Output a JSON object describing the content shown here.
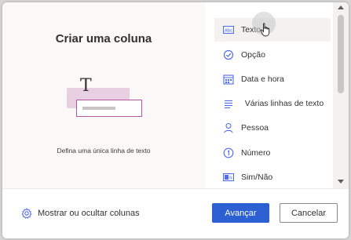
{
  "dialog": {
    "title": "Criar uma coluna",
    "description": "Defina uma única linha de texto",
    "illustration_letter": "T"
  },
  "column_types": [
    {
      "label": "Texto",
      "icon": "text-field-icon",
      "selected": true
    },
    {
      "label": "Opção",
      "icon": "check-circle-icon",
      "selected": false
    },
    {
      "label": "Data e hora",
      "icon": "calendar-icon",
      "selected": false
    },
    {
      "label": "Várias linhas de texto",
      "icon": "multiline-text-icon",
      "selected": false
    },
    {
      "label": "Pessoa",
      "icon": "person-icon",
      "selected": false
    },
    {
      "label": "Número",
      "icon": "number-icon",
      "selected": false
    },
    {
      "label": "Sim/Não",
      "icon": "toggle-icon",
      "selected": false
    }
  ],
  "footer": {
    "show_hide_label": "Mostrar ou ocultar colunas",
    "next_label": "Avançar",
    "cancel_label": "Cancelar"
  },
  "colors": {
    "accent": "#2c5fd1",
    "icon": "#4f6bed",
    "illustration_back": "#e9cfe2",
    "illustration_border": "#b4589e"
  }
}
